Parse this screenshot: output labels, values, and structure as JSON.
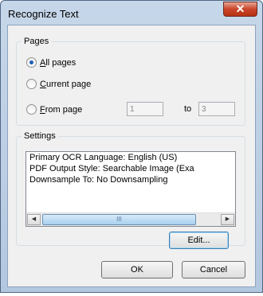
{
  "dialog": {
    "title": "Recognize Text",
    "close_glyph": "✕"
  },
  "pages": {
    "legend": "Pages",
    "options": [
      {
        "prefix": "",
        "accel": "A",
        "rest": "ll pages",
        "checked": true
      },
      {
        "prefix": "",
        "accel": "C",
        "rest": "urrent page",
        "checked": false
      },
      {
        "prefix": "",
        "accel": "F",
        "rest": "rom page",
        "checked": false
      }
    ],
    "from_value": "1",
    "to_label": "to",
    "to_value": "3"
  },
  "settings": {
    "legend": "Settings",
    "lines": [
      "Primary OCR Language: English (US)",
      "PDF Output Style: Searchable Image (Exa",
      "Downsample To: No Downsampling"
    ],
    "scroll_left": "◀",
    "scroll_right": "▶",
    "thumb_grip": "III",
    "edit_label": "Edit..."
  },
  "buttons": {
    "ok": "OK",
    "cancel": "Cancel"
  },
  "icons": {
    "close": "close-icon",
    "radio": "radio-icon"
  },
  "colors": {
    "close_button": "#c9442a",
    "radio_dot": "#1a5fb4",
    "scroll_thumb": "#a9d0ef"
  }
}
